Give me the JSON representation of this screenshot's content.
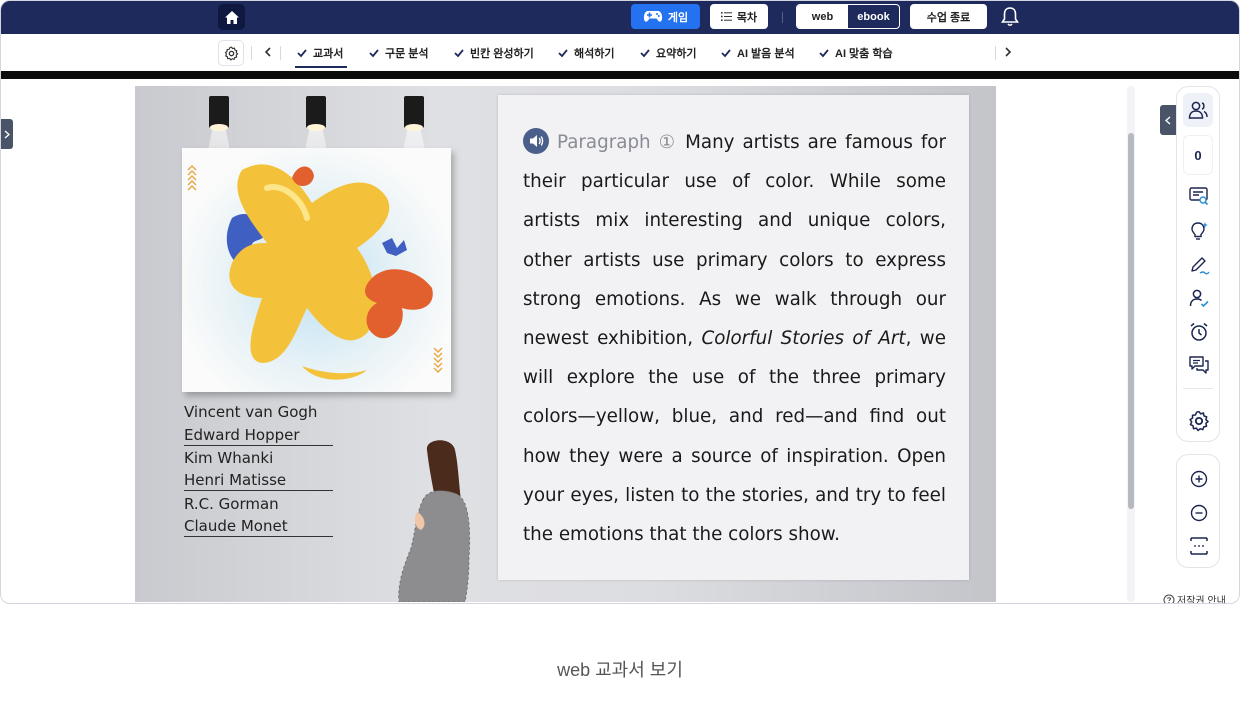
{
  "topbar": {
    "game_label": "게임",
    "toc_label": "목차",
    "view_web": "web",
    "view_ebook": "ebook",
    "end_class_label": "수업 종료",
    "colors": {
      "bg": "#1d2a5b",
      "game": "#2472f0"
    }
  },
  "tabs": [
    {
      "label": "교과서",
      "active": true
    },
    {
      "label": "구문 분석"
    },
    {
      "label": "빈칸 완성하기"
    },
    {
      "label": "해석하기"
    },
    {
      "label": "요약하기"
    },
    {
      "label": "AI 발음 분석"
    },
    {
      "label": "AI 맞춤 학습"
    }
  ],
  "artists": [
    "Vincent van Gogh",
    "Edward Hopper",
    "Kim Whanki",
    "Henri Matisse",
    "R.C. Gorman",
    "Claude Monet"
  ],
  "passage": {
    "label": "Paragraph ①",
    "text_before": "Many artists are famous for their particular use of color. While some artists mix interesting and unique colors, other artists use primary colors to express strong emotions. As we walk through our newest exhibition, ",
    "title_italic": "Colorful Stories of Art",
    "text_after": ", we will explore the use of the three primary colors—yellow, blue, and red—and find out how they were a source of inspiration. Open your eyes, listen to the stories, and try to feel the emotions that the colors show."
  },
  "side": {
    "count": "0",
    "copyright_label": "저작권 안내"
  },
  "caption": "web 교과서 보기"
}
